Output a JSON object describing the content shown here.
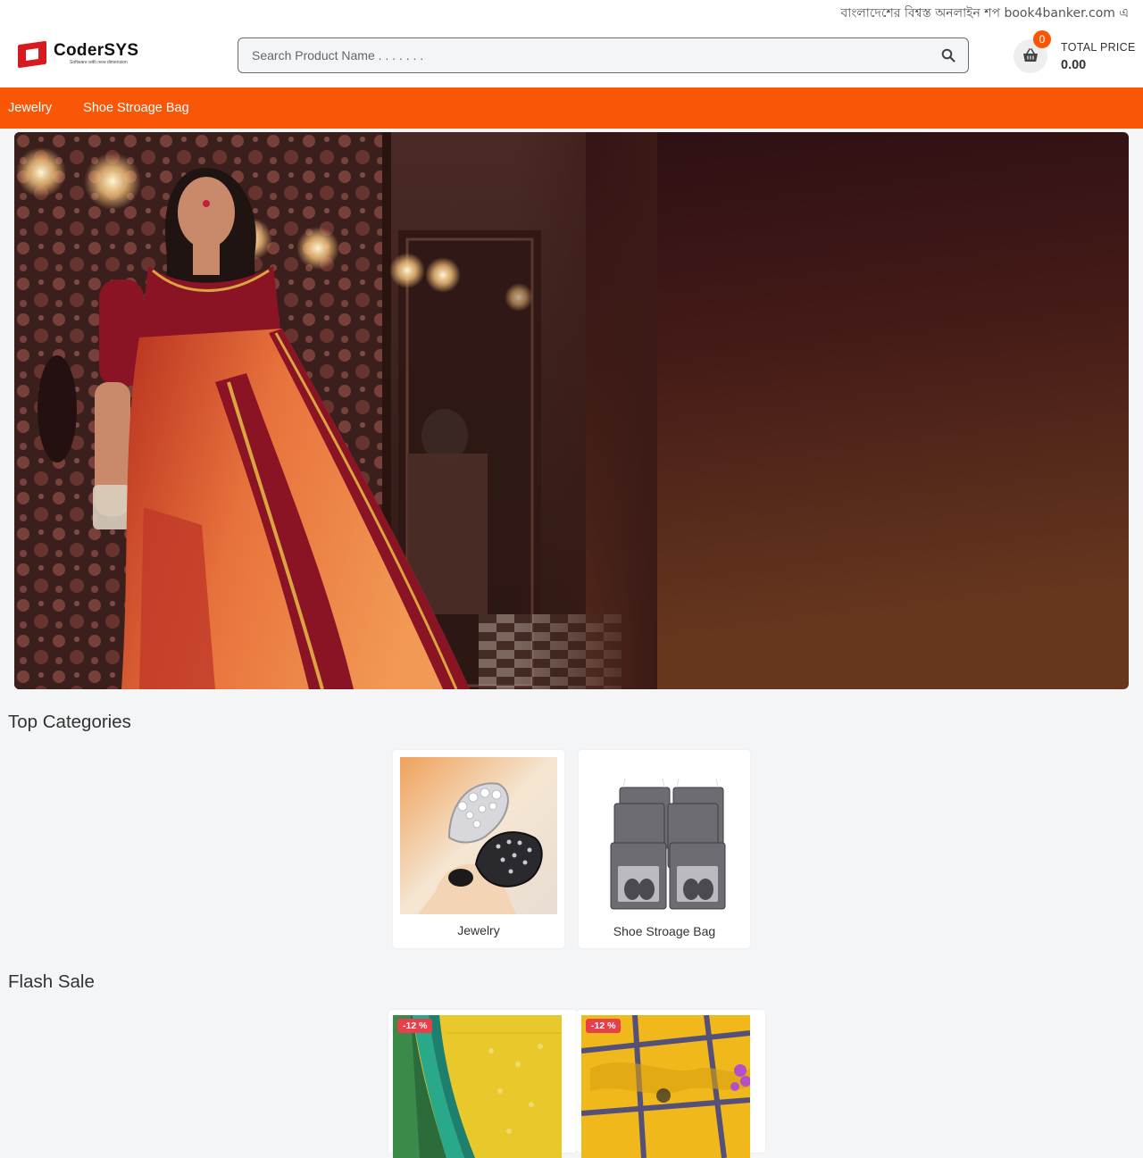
{
  "ticker": {
    "text": "বাংলাদেশের বিশ্বস্ত অনলাইন শপ book4banker.com এ"
  },
  "header": {
    "logo": {
      "name": "CoderSYS",
      "tagline": "Software with new dimension"
    },
    "search": {
      "placeholder": "Search Product Name . . . . . . .",
      "value": ""
    },
    "cart": {
      "count": "0",
      "total_label": "TOTAL PRICE",
      "total_value": "0.00"
    }
  },
  "nav": {
    "items": [
      {
        "label": "Jewelry"
      },
      {
        "label": "Shoe Stroage Bag"
      }
    ]
  },
  "sections": {
    "top_categories": {
      "title": "Top Categories",
      "items": [
        {
          "label": "Jewelry"
        },
        {
          "label": "Shoe Stroage Bag"
        }
      ]
    },
    "flash_sale": {
      "title": "Flash Sale",
      "items": [
        {
          "discount": "-12 %"
        },
        {
          "discount": "-12 %"
        }
      ]
    }
  },
  "colors": {
    "accent": "#fa5608",
    "badge": "#e8404a",
    "logo": "#d71920"
  },
  "icons": {
    "search": "search-icon",
    "cart": "basket-icon"
  }
}
